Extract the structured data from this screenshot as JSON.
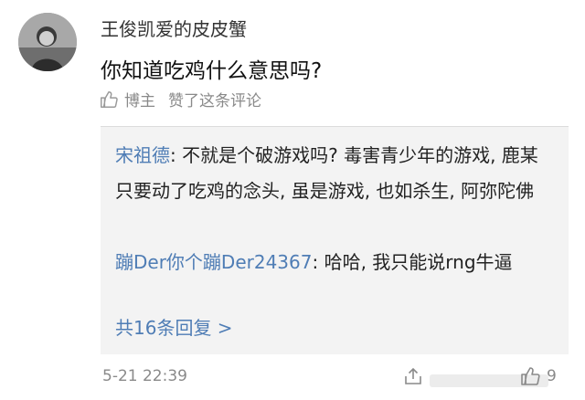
{
  "comment": {
    "username": "王俊凯爱的皮皮蟹",
    "text": "你知道吃鸡什么意思吗?",
    "liked_by": {
      "author_label": "博主",
      "action_text": "赞了这条评论"
    },
    "timestamp": "5-21 22:39",
    "like_count": "9"
  },
  "replies": [
    {
      "name": "宋祖德",
      "separator": ": ",
      "text": "不就是个破游戏吗? 毒害青少年的游戏, 鹿某只要动了吃鸡的念头, 虽是游戏, 也如杀生, 阿弥陀佛"
    },
    {
      "name": "蹦Der你个蹦Der24367",
      "separator": ": ",
      "text": "哈哈, 我只能说rng牛逼"
    }
  ],
  "more_replies_label": "共16条回复 >",
  "colors": {
    "link": "#4f7db5",
    "meta": "#8a8a8a",
    "reply_bg": "#f3f3f3"
  },
  "icons": [
    "avatar",
    "thumbs-up-icon",
    "share-icon",
    "like-icon"
  ]
}
